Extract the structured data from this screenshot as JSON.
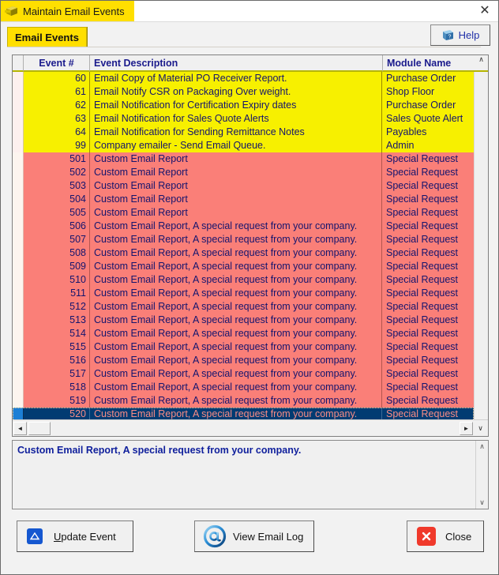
{
  "window": {
    "title": "Maintain Email Events",
    "title_icon": "app-icon",
    "close_glyph": "✕"
  },
  "toolbar": {
    "tab_label": "Email Events",
    "help_label": "Help",
    "help_icon": "help-book-icon"
  },
  "grid": {
    "columns": [
      {
        "key": "marker",
        "label": ""
      },
      {
        "key": "event_no",
        "label": "Event #"
      },
      {
        "key": "description",
        "label": "Event Description"
      },
      {
        "key": "module",
        "label": "Module Name"
      }
    ],
    "scroll_up_glyph": "∧",
    "scroll_down_glyph": "∨",
    "scroll_left_glyph": "◄",
    "scroll_right_glyph": "►",
    "rows": [
      {
        "event_no": "60",
        "description": "Email Copy of Material PO Receiver Report.",
        "module": "Purchase Order",
        "style": "yellow"
      },
      {
        "event_no": "61",
        "description": "Email Notify CSR on Packaging Over weight.",
        "module": "Shop Floor",
        "style": "yellow"
      },
      {
        "event_no": "62",
        "description": "Email Notification for Certification Expiry dates",
        "module": "Purchase Order",
        "style": "yellow"
      },
      {
        "event_no": "63",
        "description": "Email Notification for Sales Quote Alerts",
        "module": "Sales Quote Alert",
        "style": "yellow"
      },
      {
        "event_no": "64",
        "description": "Email Notification for Sending Remittance Notes",
        "module": "Payables",
        "style": "yellow"
      },
      {
        "event_no": "99",
        "description": "Company emailer - Send Email Queue.",
        "module": "Admin",
        "style": "yellow"
      },
      {
        "event_no": "501",
        "description": "Custom Email Report",
        "module": "Special Request",
        "style": "pink"
      },
      {
        "event_no": "502",
        "description": "Custom Email Report",
        "module": "Special Request",
        "style": "pink"
      },
      {
        "event_no": "503",
        "description": "Custom Email Report",
        "module": "Special Request",
        "style": "pink"
      },
      {
        "event_no": "504",
        "description": "Custom Email Report",
        "module": "Special Request",
        "style": "pink"
      },
      {
        "event_no": "505",
        "description": "Custom Email Report",
        "module": "Special Request",
        "style": "pink"
      },
      {
        "event_no": "506",
        "description": "Custom Email Report, A special request from your company.",
        "module": "Special Request",
        "style": "pink"
      },
      {
        "event_no": "507",
        "description": "Custom Email Report, A special request from your company.",
        "module": "Special Request",
        "style": "pink"
      },
      {
        "event_no": "508",
        "description": "Custom Email Report, A special request from your company.",
        "module": "Special Request",
        "style": "pink"
      },
      {
        "event_no": "509",
        "description": "Custom Email Report, A special request from your company.",
        "module": "Special Request",
        "style": "pink"
      },
      {
        "event_no": "510",
        "description": "Custom Email Report, A special request from your company.",
        "module": "Special Request",
        "style": "pink"
      },
      {
        "event_no": "511",
        "description": "Custom Email Report, A special request from your company.",
        "module": "Special Request",
        "style": "pink"
      },
      {
        "event_no": "512",
        "description": "Custom Email Report, A special request from your company.",
        "module": "Special Request",
        "style": "pink"
      },
      {
        "event_no": "513",
        "description": "Custom Email Report, A special request from your company.",
        "module": "Special Request",
        "style": "pink"
      },
      {
        "event_no": "514",
        "description": "Custom Email Report, A special request from your company.",
        "module": "Special Request",
        "style": "pink"
      },
      {
        "event_no": "515",
        "description": "Custom Email Report, A special request from your company.",
        "module": "Special Request",
        "style": "pink"
      },
      {
        "event_no": "516",
        "description": "Custom Email Report, A special request from your company.",
        "module": "Special Request",
        "style": "pink"
      },
      {
        "event_no": "517",
        "description": "Custom Email Report, A special request from your company.",
        "module": "Special Request",
        "style": "pink"
      },
      {
        "event_no": "518",
        "description": "Custom Email Report, A special request from your company.",
        "module": "Special Request",
        "style": "pink"
      },
      {
        "event_no": "519",
        "description": "Custom Email Report, A special request from your company.",
        "module": "Special Request",
        "style": "pink"
      },
      {
        "event_no": "520",
        "description": "Custom Email Report, A special request from your company.",
        "module": "Special Request",
        "style": "selected"
      }
    ]
  },
  "memo": {
    "value": "Custom Email Report, A special request from your company."
  },
  "buttons": {
    "update": {
      "label_accel": "U",
      "label_rest": "pdate Event",
      "icon": "triangle-up-icon"
    },
    "view_log": {
      "label": "View Email Log",
      "icon": "at-sign-icon"
    },
    "close": {
      "label": "Close",
      "icon": "close-x-icon"
    }
  },
  "colors": {
    "title_bar": "#ffdf00",
    "tab": "#ffdf00",
    "row_yellow": "#f7f000",
    "row_pink": "#fa7f78",
    "row_selected_bg": "#013b72",
    "row_selected_fg": "#fa8c85",
    "text_navy": "#14146e",
    "accent_blue": "#1f2fa8",
    "close_red": "#f0392b"
  }
}
